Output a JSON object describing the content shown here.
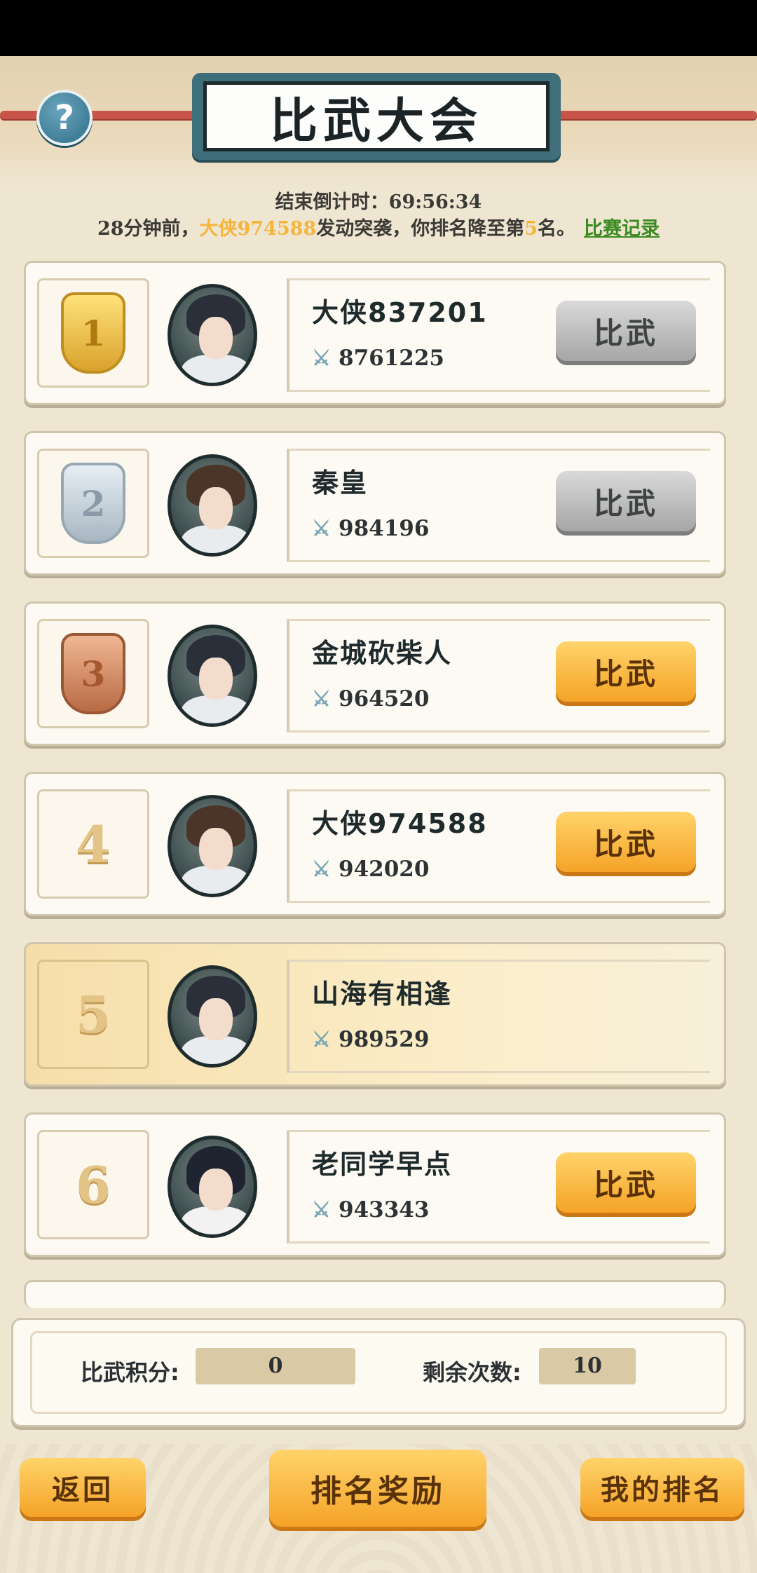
{
  "title": "比武大会",
  "countdown": "结束倒计时：69:56:34",
  "notice": {
    "prefix": "28分钟前，",
    "attacker": "大侠974588",
    "middle": "发动突袭，你排名降至第",
    "rank": "5",
    "suffix": "名。",
    "link": "比赛记录"
  },
  "players": [
    {
      "rank": "1",
      "name": "大侠837201",
      "power": "8761225",
      "button": "比武",
      "button_state": "disabled"
    },
    {
      "rank": "2",
      "name": "秦皇",
      "power": "984196",
      "button": "比武",
      "button_state": "disabled"
    },
    {
      "rank": "3",
      "name": "金城砍柴人",
      "power": "964520",
      "button": "比武",
      "button_state": "active"
    },
    {
      "rank": "4",
      "name": "大侠974588",
      "power": "942020",
      "button": "比武",
      "button_state": "active"
    },
    {
      "rank": "5",
      "name": "山海有相逢",
      "power": "989529",
      "button": "",
      "button_state": "self"
    },
    {
      "rank": "6",
      "name": "老同学早点",
      "power": "943343",
      "button": "比武",
      "button_state": "active"
    }
  ],
  "score": {
    "points_label": "比武积分:",
    "points_value": "0",
    "remaining_label": "剩余次数:",
    "remaining_value": "10"
  },
  "footer": {
    "back": "返回",
    "rewards": "排名奖励",
    "my_rank": "我的排名"
  },
  "colors": {
    "accent_orange": "#f5a327",
    "highlight": "#f5b43a",
    "link_green": "#3c8a22",
    "title_frame": "#3f6f7a"
  },
  "icons": {
    "help": "?",
    "sword": "⚔"
  }
}
